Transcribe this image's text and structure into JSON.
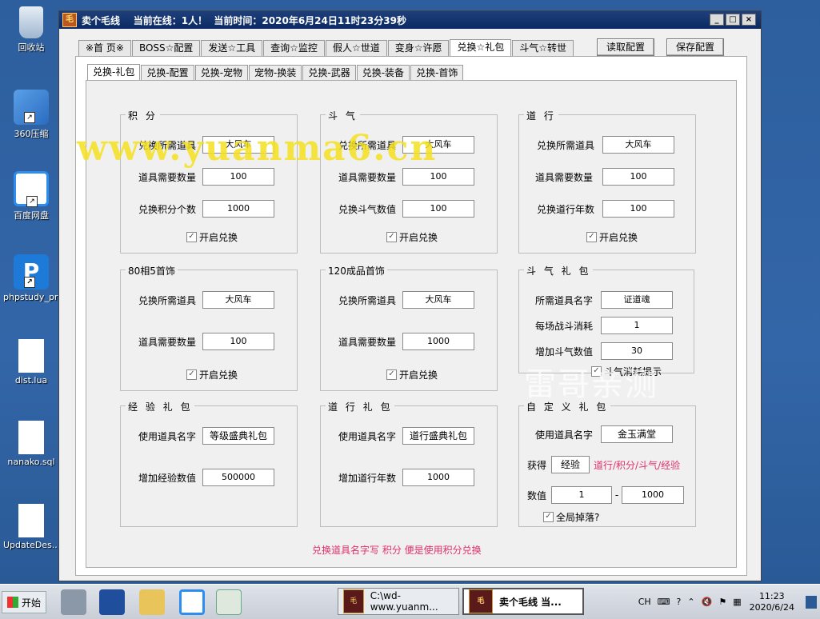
{
  "desktop": {
    "icons": [
      {
        "label": "回收站",
        "icon": "recycle-bin-icon"
      },
      {
        "label": "360压缩",
        "icon": "zip-folder-icon"
      },
      {
        "label": "百度网盘",
        "icon": "baidu-netdisk-icon"
      },
      {
        "label": "phpstudy_pro",
        "icon": "phpstudy-icon"
      },
      {
        "label": "dist.lua",
        "icon": "file-icon"
      },
      {
        "label": "nanako.sql",
        "icon": "file-icon"
      },
      {
        "label": "UpdateDes...",
        "icon": "file-icon"
      }
    ],
    "watermark": "www.yuanma6.cn",
    "watermark2": "雷哥亲测"
  },
  "window": {
    "title": "卖个毛线    当前在线：1人！  当前时间：2020年6月24日11时23分39秒",
    "controls": {
      "minimize": "_",
      "maximize": "□",
      "close": "×"
    },
    "tabs": [
      "※首 页※",
      "BOSS☆配置",
      "发送☆工具",
      "查询☆监控",
      "假人☆世道",
      "变身☆许愿",
      "兑换☆礼包",
      "斗气☆转世"
    ],
    "active_tab": "兑换☆礼包",
    "read_config": "读取配置",
    "save_config": "保存配置",
    "subtabs": [
      "兑换-礼包",
      "兑换-配置",
      "兑换-宠物",
      "宠物-换装",
      "兑换-武器",
      "兑换-装备",
      "兑换-首饰"
    ],
    "active_subtab": "兑换-礼包"
  },
  "groups": {
    "jifen": {
      "title": "积 分",
      "rows": [
        {
          "label": "兑换所需道具",
          "value": "大风车"
        },
        {
          "label": "道具需要数量",
          "value": "100"
        },
        {
          "label": "兑换积分个数",
          "value": "1000"
        }
      ],
      "check": "开启兑换"
    },
    "douqi": {
      "title": "斗 气",
      "rows": [
        {
          "label": "兑换所需道具",
          "value": "大风车"
        },
        {
          "label": "道具需要数量",
          "value": "100"
        },
        {
          "label": "兑换斗气数值",
          "value": "100"
        }
      ],
      "check": "开启兑换"
    },
    "daoxing": {
      "title": "道 行",
      "rows": [
        {
          "label": "兑换所需道具",
          "value": "大风车"
        },
        {
          "label": "道具需要数量",
          "value": "100"
        },
        {
          "label": "兑换道行年数",
          "value": "100"
        }
      ],
      "check": "开启兑换"
    },
    "shoushi80": {
      "title": "80相5首饰",
      "rows": [
        {
          "label": "兑换所需道具",
          "value": "大风车"
        },
        {
          "label": "道具需要数量",
          "value": "100"
        }
      ],
      "check": "开启兑换"
    },
    "shoushi120": {
      "title": "120成品首饰",
      "rows": [
        {
          "label": "兑换所需道具",
          "value": "大风车"
        },
        {
          "label": "道具需要数量",
          "value": "1000"
        }
      ],
      "check": "开启兑换"
    },
    "douqilibao": {
      "title": "斗 气 礼 包",
      "rows": [
        {
          "label": "所需道具名字",
          "value": "证道魂"
        },
        {
          "label": "每场战斗消耗",
          "value": "1"
        },
        {
          "label": "增加斗气数值",
          "value": "30"
        }
      ],
      "check": "斗气消耗提示"
    },
    "jingyan": {
      "title": "经 验 礼 包",
      "rows": [
        {
          "label": "使用道具名字",
          "value": "等级盛典礼包"
        },
        {
          "label": "增加经验数值",
          "value": "500000"
        }
      ]
    },
    "daoxinglibao": {
      "title": "道 行 礼 包",
      "rows": [
        {
          "label": "使用道具名字",
          "value": "道行盛典礼包"
        },
        {
          "label": "增加道行年数",
          "value": "1000"
        }
      ]
    },
    "zidingyi": {
      "title": "自 定 义 礼 包",
      "item_label": "使用道具名字",
      "item_value": "金玉满堂",
      "get_label": "获得",
      "get_value": "经验",
      "get_hint": "道行/积分/斗气/经验",
      "range_label": "数值",
      "range_min": "1",
      "range_sep": "-",
      "range_max": "1000",
      "check": "全局掉落?"
    }
  },
  "footer_note": "兑换道具名字写 积分 便是使用积分兑换",
  "taskbar": {
    "start": "开始",
    "tasks": [
      {
        "label": "C:\\wd-www.yuanm...",
        "active": false
      },
      {
        "label": "卖个毛线    当...",
        "active": true
      }
    ],
    "tray": {
      "ime": "CH",
      "time": "11:23",
      "date": "2020/6/24"
    }
  }
}
